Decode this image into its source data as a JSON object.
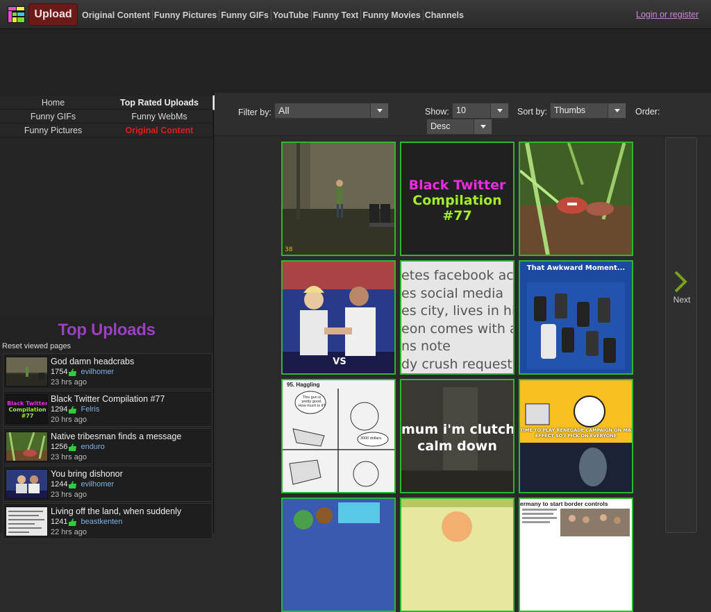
{
  "colors": {
    "upload_bg": "#6b1a1a",
    "nav_text": "#cfcfcf",
    "login": "#c78ad6",
    "active_red": "#e01c1c",
    "top_uploads_title": "#9b3fc4",
    "username": "#7fb2e8",
    "thumbs_up": "#2ecc40",
    "tile_border": "#2eb82e"
  },
  "header": {
    "upload_label": "Upload",
    "nav": [
      "Original Content",
      "Funny Pictures",
      "Funny GIFs",
      "YouTube",
      "Funny Text",
      "Funny Movies",
      "Channels"
    ],
    "login_label": "Login or register"
  },
  "sidebar": {
    "menu": [
      {
        "label": "Home"
      },
      {
        "label": "Top Rated Uploads"
      },
      {
        "label": "Funny GIFs"
      },
      {
        "label": "Funny WebMs"
      },
      {
        "label": "Funny Pictures"
      },
      {
        "label": "Original Content"
      }
    ],
    "top_uploads_title": "Top Uploads",
    "reset_label": "Reset viewed pages",
    "uploads": [
      {
        "title": "God damn headcrabs",
        "count": "1754",
        "user": "evilhomer",
        "time": "23 hrs ago",
        "thumb_icon": "game-screenshot-thumbnail"
      },
      {
        "title": "Black Twitter Compilation #77",
        "count": "1294",
        "user": "Felris",
        "time": "20 hrs ago",
        "thumb_icon": "black-twitter-thumbnail"
      },
      {
        "title": "Native tribesman finds a message",
        "count": "1256",
        "user": "enduro",
        "time": "23 hrs ago",
        "thumb_icon": "jungle-thumbnail"
      },
      {
        "title": "You bring dishonor",
        "count": "1244",
        "user": "evilhomer",
        "time": "23 hrs ago",
        "thumb_icon": "arm-wrestling-thumbnail"
      },
      {
        "title": "Living off the land, when suddenly",
        "count": "1241",
        "user": "beastkenten",
        "time": "22 hrs ago",
        "thumb_icon": "text-post-thumbnail"
      }
    ]
  },
  "filters": {
    "filter_label": "Filter by:",
    "filter_value": "All",
    "show_label": "Show:",
    "show_value": "10",
    "sort_label": "Sort by:",
    "sort_value": "Thumbs",
    "order_label": "Order:",
    "order_value": "Desc"
  },
  "grid": {
    "tiles": [
      {
        "name": "headcrabs-tile",
        "overlay": "38"
      },
      {
        "name": "black-twitter-tile",
        "lines": [
          "Black Twitter",
          "Compilation",
          "#77"
        ]
      },
      {
        "name": "tribesman-tile"
      },
      {
        "name": "dishonor-tile",
        "overlay": "VS"
      },
      {
        "name": "facebook-text-tile",
        "lines": [
          "etes facebook accou",
          "es social media",
          "es city, lives in hima",
          "eon comes with a no",
          "ns note",
          "dy crush request"
        ]
      },
      {
        "name": "awkward-moment-tile",
        "lines": [
          "That Awkward Moment..."
        ]
      },
      {
        "name": "haggling-comic-tile",
        "lines": [
          "95. Haggling",
          "This gun is pretty good. How much is it?",
          "3000 dollars."
        ]
      },
      {
        "name": "clutching-tile",
        "lines": [
          "mum i'm clutchir",
          "calm down"
        ]
      },
      {
        "name": "mass-effect-tile",
        "lines": [
          "TIME TO PLAY RENEGADE CAMPAIGN ON MASS",
          "EFFECT SO I PICK ON EVERYONE"
        ]
      },
      {
        "name": "anime-tile"
      },
      {
        "name": "cartoon-tile"
      },
      {
        "name": "border-controls-tile",
        "lines": [
          "ermany to start border controls"
        ]
      }
    ]
  },
  "next_label": "Next"
}
